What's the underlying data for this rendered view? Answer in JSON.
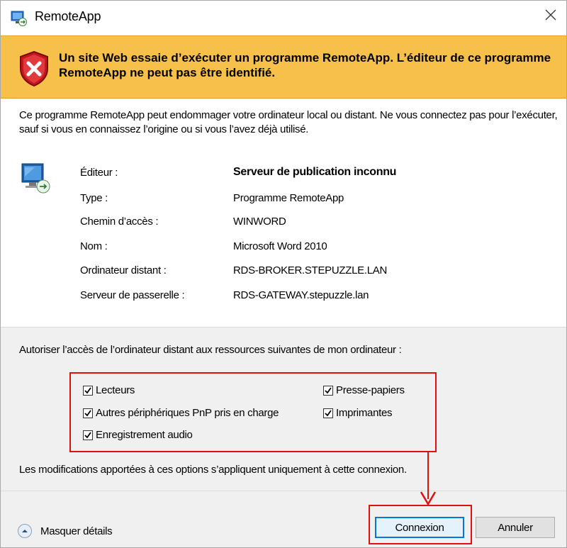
{
  "window": {
    "title": "RemoteApp",
    "close_glyph": "✕"
  },
  "banner": {
    "text": "Un site Web essaie d’exécuter un programme RemoteApp. L’éditeur de ce programme RemoteApp ne peut pas être identifié.",
    "icon": "security-warning-shield-icon"
  },
  "intro": {
    "text": "Ce programme RemoteApp peut endommager votre ordinateur local ou distant. Ne vous connectez pas pour l’exécuter, sauf si vous en connaissez l’origine ou si vous l’avez déjà utilisé."
  },
  "details": [
    {
      "label": "Éditeur :",
      "value": "Serveur de publication inconnu"
    },
    {
      "label": "Type :",
      "value": "Programme RemoteApp"
    },
    {
      "label": "Chemin d’accès :",
      "value": "WINWORD"
    },
    {
      "label": "Nom :",
      "value": "Microsoft Word 2010"
    },
    {
      "label": "Ordinateur distant :",
      "value": "RDS-BROKER.STEPUZZLE.LAN"
    },
    {
      "label": "Serveur de passerelle :",
      "value": "RDS-GATEWAY.stepuzzle.lan"
    }
  ],
  "resources": {
    "heading": "Autoriser l’accès de l’ordinateur distant aux ressources suivantes de mon ordinateur :",
    "options": [
      {
        "label": "Lecteurs",
        "checked": true
      },
      {
        "label": "Presse-papiers",
        "checked": true
      },
      {
        "label": "Autres périphériques PnP pris en charge",
        "checked": true
      },
      {
        "label": "Imprimantes",
        "checked": true
      },
      {
        "label": "Enregistrement audio",
        "checked": true
      }
    ],
    "note": "Les modifications apportées à ces options s’appliquent uniquement à cette connexion."
  },
  "footer": {
    "toggle_label": "Masquer détails",
    "connect_label": "Connexion",
    "cancel_label": "Annuler"
  },
  "colors": {
    "banner": "#f7c04a",
    "highlight": "#e01010",
    "default_button_border": "#0078d7"
  }
}
